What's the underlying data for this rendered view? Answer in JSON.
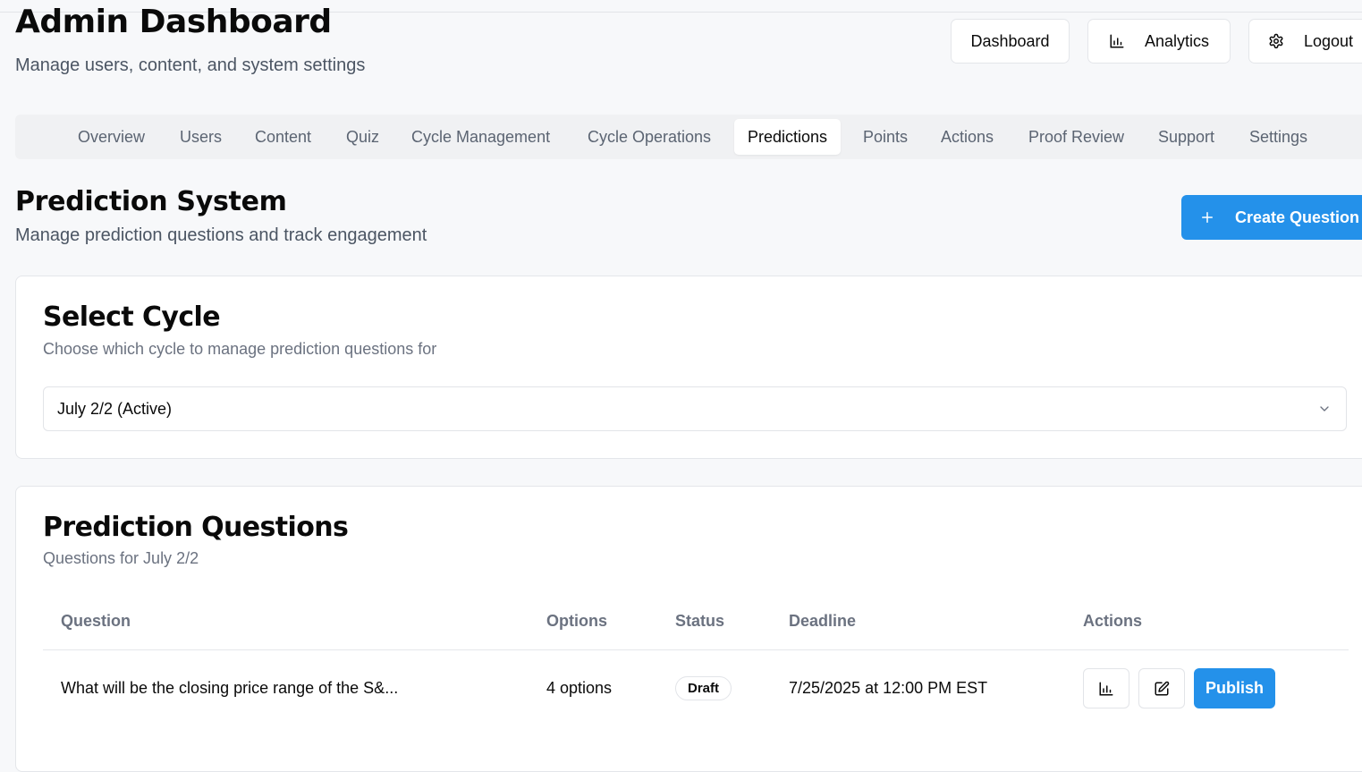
{
  "header": {
    "title": "Admin Dashboard",
    "subtitle": "Manage users, content, and system settings",
    "buttons": {
      "dashboard": "Dashboard",
      "analytics": "Analytics",
      "logout": "Logout"
    }
  },
  "tabs": [
    {
      "label": "Overview",
      "active": false
    },
    {
      "label": "Users",
      "active": false
    },
    {
      "label": "Content",
      "active": false
    },
    {
      "label": "Quiz",
      "active": false
    },
    {
      "label": "Cycle Management",
      "active": false
    },
    {
      "label": "Cycle Operations",
      "active": false
    },
    {
      "label": "Predictions",
      "active": true
    },
    {
      "label": "Points",
      "active": false
    },
    {
      "label": "Actions",
      "active": false
    },
    {
      "label": "Proof Review",
      "active": false
    },
    {
      "label": "Support",
      "active": false
    },
    {
      "label": "Settings",
      "active": false
    }
  ],
  "section": {
    "title": "Prediction System",
    "subtitle": "Manage prediction questions and track engagement",
    "create_button": "Create Question"
  },
  "select_cycle": {
    "title": "Select Cycle",
    "description": "Choose which cycle to manage prediction questions for",
    "selected": "July 2/2 (Active)"
  },
  "questions": {
    "title": "Prediction Questions",
    "description": "Questions for July 2/2",
    "columns": [
      "Question",
      "Options",
      "Status",
      "Deadline",
      "Actions"
    ],
    "rows": [
      {
        "question": "What will be the closing price range of the S&...",
        "options": "4 options",
        "status": "Draft",
        "deadline": "7/25/2025 at 12:00 PM EST",
        "publish_label": "Publish"
      }
    ]
  },
  "colors": {
    "accent": "#2491ea",
    "background": "#f7f8fa",
    "muted_text": "#6b7280"
  },
  "icons": {
    "analytics": "bar-chart-icon",
    "logout": "gear-icon",
    "create": "plus-icon",
    "select": "chevron-down-icon",
    "row_stats": "bar-chart-icon",
    "row_edit": "edit-icon"
  }
}
